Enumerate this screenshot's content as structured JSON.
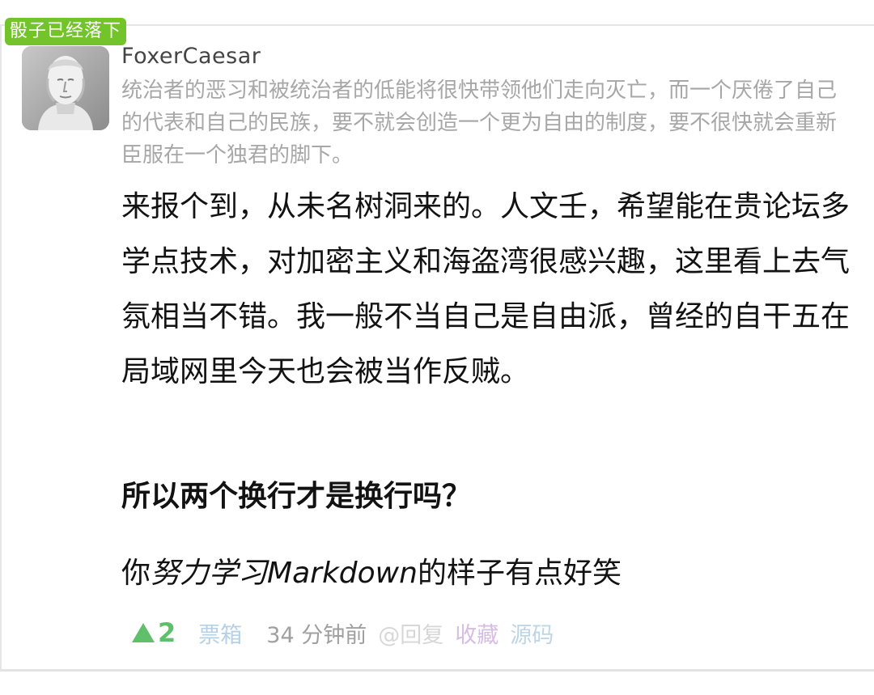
{
  "post": {
    "badge": "骰子已经落下",
    "author": "FoxerCaesar",
    "signature": "统治者的恶习和被统治者的低能将很快带领他们走向灭亡，而一个厌倦了自己的代表和自己的民族，要不就会创造一个更为自由的制度，要不很快就会重新臣服在一个独君的脚下。",
    "body_paragraph": "来报个到，从未名树洞来的。人文壬，希望能在贵论坛多学点技术，对加密主义和海盗湾很感兴趣，这里看上去气氛相当不错。我一般不当自己是自由派，曾经的自干五在局域网里今天也会被当作反贼。",
    "heading": "所以两个换行才是换行吗？",
    "md_prefix": "你",
    "md_italic": "努力学习Markdown",
    "md_suffix": "的样子有点好笑"
  },
  "footer": {
    "vote_count": "2",
    "ballot": "票箱",
    "time": "34 分钟前",
    "reply": "@回复",
    "favorite": "收藏",
    "source": "源码"
  },
  "colors": {
    "badge": "#73c42a",
    "vote": "#5fbf6a",
    "ballot": "#b6d1e4",
    "favorite": "#d6bde2",
    "source": "#bdd6e6"
  },
  "icons": {
    "vote": "up-triangle-icon"
  }
}
